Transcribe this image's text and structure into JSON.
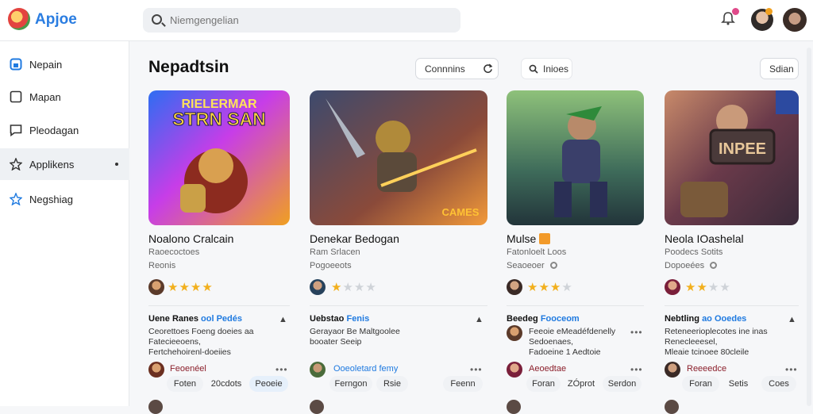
{
  "app": {
    "brand": "Apjoe"
  },
  "search": {
    "placeholder": "Niemgengelian"
  },
  "sidebar": {
    "items": [
      {
        "label": "Nepain",
        "icon": "home-icon"
      },
      {
        "label": "Mapan",
        "icon": "square-icon"
      },
      {
        "label": "Pleodagan",
        "icon": "message-icon"
      },
      {
        "label": "Applikens",
        "icon": "puzzle-icon",
        "active": true
      },
      {
        "label": "Negshiag",
        "icon": "star-outline-icon"
      }
    ]
  },
  "main": {
    "title": "Nepadtsin",
    "filters": {
      "sort_label": "Connnins",
      "search_label": "Inioes",
      "save_label": "Sdian"
    }
  },
  "cards": [
    {
      "title": "Noalono Cralcain",
      "sub1": "Raoecoctoes",
      "sub2": "Reonis",
      "rating": 4,
      "section_head": "Uene Ranes",
      "section_accent": "ool Pedés",
      "body": [
        "Ceorettoes Foeng doeies aa",
        "Fatecieeoens,",
        "Fertchehoirenl-doeiies"
      ],
      "reviewer": "Feoenéel",
      "chips": [
        "Foten",
        "20cdots",
        "Peoeie"
      ],
      "thumb_text": [
        "RIELERMAR",
        "STRN SAN"
      ]
    },
    {
      "title": "Denekar Bedogan",
      "sub1": "Ram Srlacen",
      "sub2": "Pogoeeots",
      "rating": 1,
      "section_head": "Uebstao",
      "section_accent": "Fenis",
      "body": [
        "Gerayaor Be Maltgoolee",
        "booater Seeip"
      ],
      "reviewer": "Ooeoletard femy",
      "chips": [
        "Ferngon",
        "Rsie",
        "Feenn"
      ],
      "thumb_text": [
        "CAMES"
      ]
    },
    {
      "title": "Mulse",
      "sub1": "Fatonloelt Loos",
      "sub2": "Seaoeoer",
      "rating": 3,
      "section_head": "Beedeg",
      "section_accent": "Fooceom",
      "body": [
        "Feeoie eMeadéfdenelly",
        "Sedoenaes,",
        "Fadoeine 1 Aedtoie"
      ],
      "reviewer": "Aeoedtae",
      "chips": [
        "Foran",
        "ZÓprot",
        "Serdon"
      ],
      "thumb_text": []
    },
    {
      "title": "Neola IOashelal",
      "sub1": "Poodecs Sotits",
      "sub2": "Dopoeées",
      "rating": 2,
      "section_head": "Nebtling",
      "section_accent": "ao Ooedes",
      "body": [
        "Reteneerioplecotes ine inas",
        "Renecleeesel,",
        "Mleaie tcinoee 80cleile"
      ],
      "reviewer": "Reeeedce",
      "chips": [
        "Foran",
        "Setis",
        "Coes"
      ],
      "thumb_text": [
        "INPEE"
      ]
    }
  ],
  "colors": {
    "accent": "#1f7ae0",
    "star": "#f2b01e",
    "star_empty": "#cfd3d8"
  }
}
